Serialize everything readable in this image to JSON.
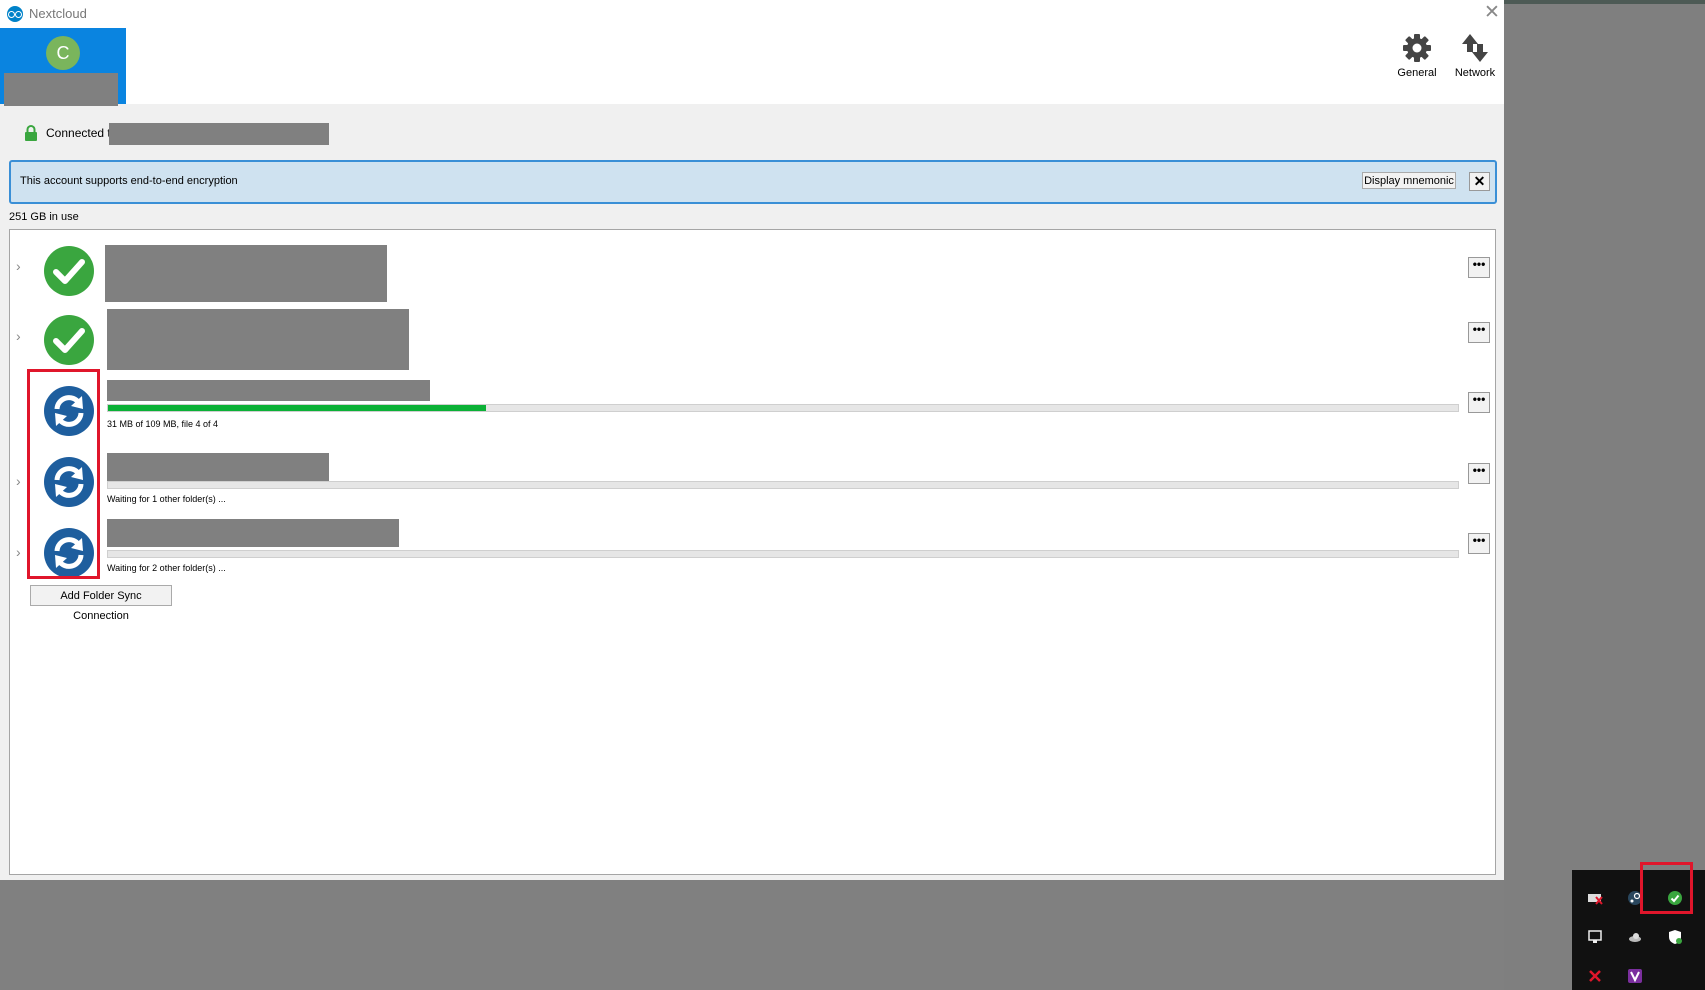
{
  "window": {
    "title": "Nextcloud"
  },
  "account": {
    "avatar_letter": "C"
  },
  "toolbar": {
    "general_label": "General",
    "network_label": "Network"
  },
  "connection": {
    "prefix": "Connected to"
  },
  "e2e": {
    "message": "This account supports end-to-end encryption",
    "mnemonic_button": "Display mnemonic"
  },
  "storage": {
    "usage": "251 GB in use"
  },
  "folders": [
    {
      "status": "ok"
    },
    {
      "status": "ok"
    },
    {
      "status": "syncing",
      "progress_text": "31 MB of 109 MB, file 4 of 4",
      "progress_fraction": 0.28
    },
    {
      "status": "syncing",
      "progress_text": "Waiting for 1 other folder(s) ...",
      "progress_fraction": 0
    },
    {
      "status": "syncing",
      "progress_text": "Waiting for 2 other folder(s) ...",
      "progress_fraction": 0
    }
  ],
  "buttons": {
    "add_folder_sync": "Add Folder Sync Connection"
  },
  "colors": {
    "accent": "#0a84e0",
    "ok": "#3aa63f",
    "sync": "#1e5e9e",
    "progress": "#0bb136",
    "highlight": "#e0162b"
  },
  "icons": {
    "general": "gear-icon",
    "network": "network-arrows-icon",
    "lock": "lock-icon",
    "ok": "check-circle-icon",
    "syncing": "sync-circle-icon",
    "more": "more-dots-icon"
  }
}
